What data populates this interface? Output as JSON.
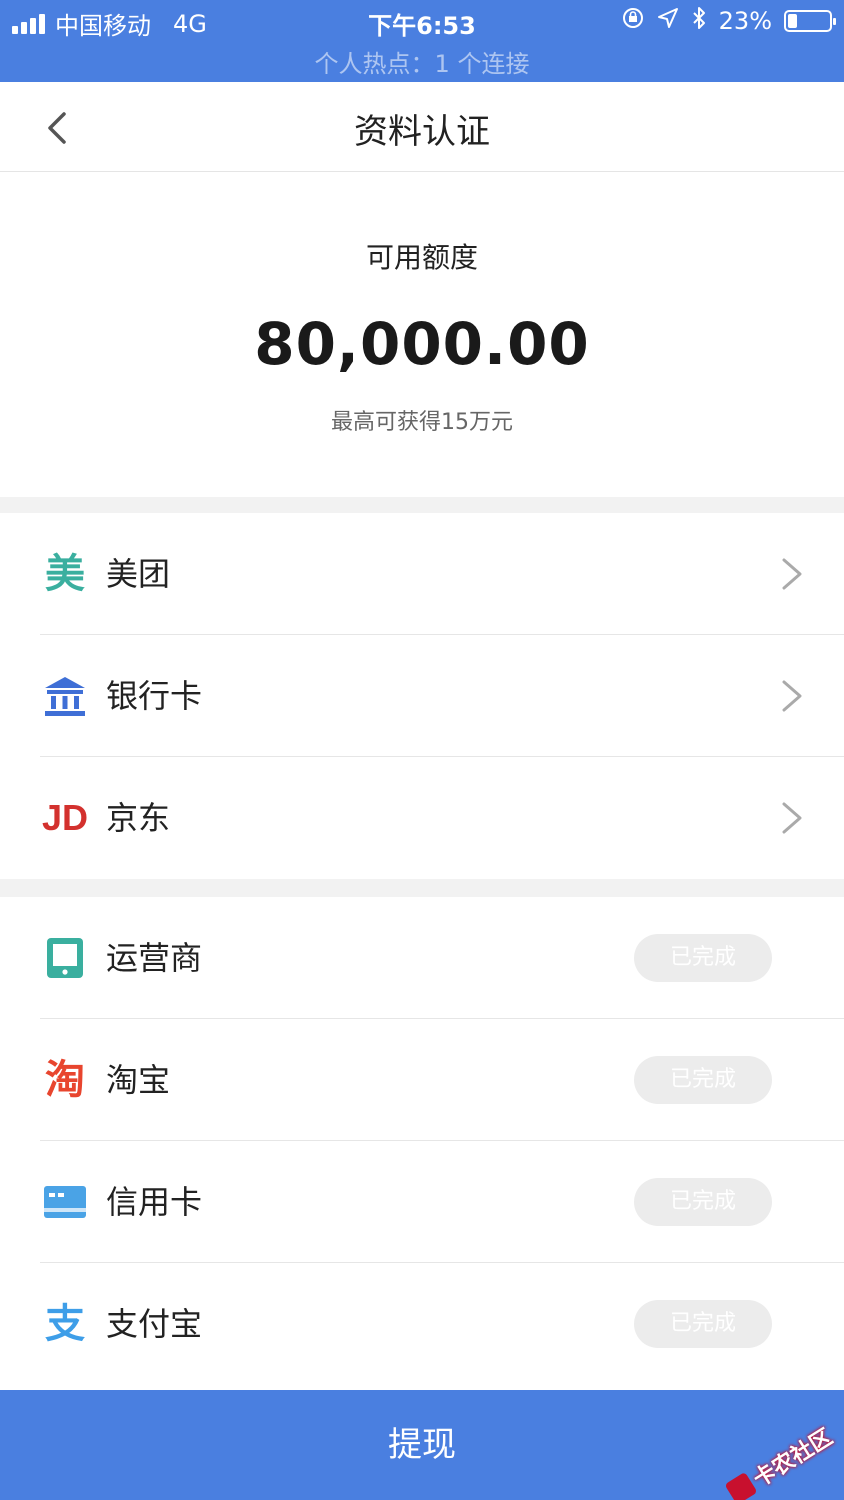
{
  "status_bar": {
    "carrier": "中国移动",
    "network": "4G",
    "time": "下午6:53",
    "battery": "23%",
    "battery_level": 0.23,
    "hotspot": "个人热点：1 个连接"
  },
  "nav": {
    "title": "资料认证"
  },
  "quota": {
    "label": "可用额度",
    "amount": "80,000.00",
    "sub": "最高可获得15万元"
  },
  "pending_items": [
    {
      "label": "美团",
      "icon": "meituan-icon",
      "color": "#3aaf9f",
      "glyph": "美"
    },
    {
      "label": "银行卡",
      "icon": "bank-icon",
      "color": "#3f6fd6"
    },
    {
      "label": "京东",
      "icon": "jd-icon",
      "color": "#d3312e",
      "glyph": "JD"
    }
  ],
  "done_items": [
    {
      "label": "运营商",
      "icon": "phone-icon",
      "color": "#3aaf9f",
      "status": "已完成"
    },
    {
      "label": "淘宝",
      "icon": "taobao-icon",
      "color": "#e8452e",
      "glyph": "淘",
      "status": "已完成"
    },
    {
      "label": "信用卡",
      "icon": "credit-card-icon",
      "color": "#4aa3e6",
      "status": "已完成"
    },
    {
      "label": "支付宝",
      "icon": "alipay-icon",
      "color": "#3e9ee8",
      "glyph": "支",
      "status": "已完成"
    }
  ],
  "withdraw_label": "提现",
  "watermark": "卡农社区"
}
